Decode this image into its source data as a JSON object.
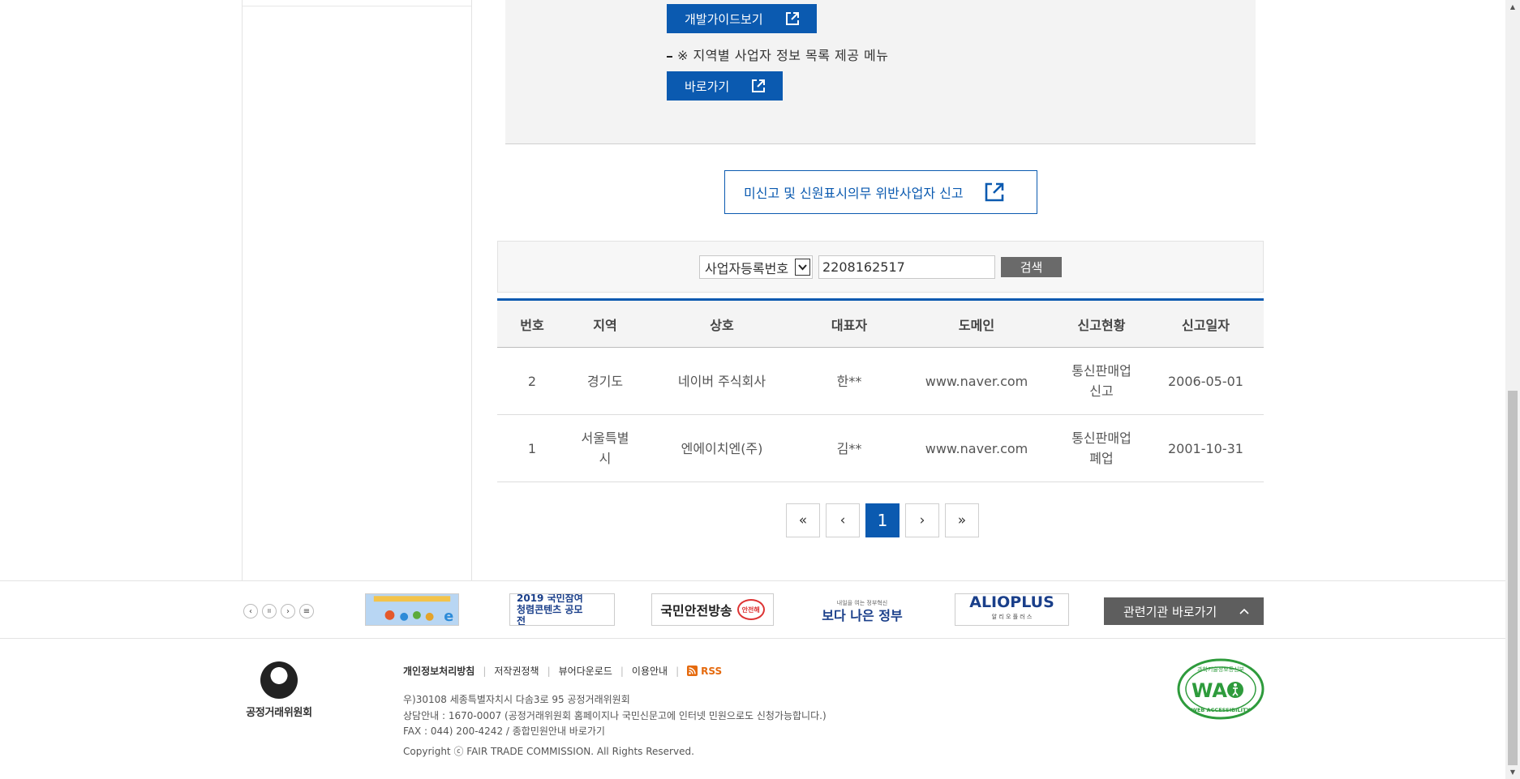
{
  "info_panel": {
    "dev_guide_button": "개발가이드보기",
    "description": "※ 지역별 사업자 정보 목록 제공 메뉴",
    "goto_button": "바로가기"
  },
  "report_button": "미신고 및 신원표시의무 위반사업자 신고",
  "search": {
    "select_value": "사업자등록번호",
    "input_value": "2208162517",
    "button_label": "검색"
  },
  "table": {
    "headers": [
      "번호",
      "지역",
      "상호",
      "대표자",
      "도메인",
      "신고현황",
      "신고일자"
    ],
    "rows": [
      {
        "no": "2",
        "region": "경기도",
        "company": "네이버 주식회사",
        "ceo": "한**",
        "domain": "www.naver.com",
        "status": "통신판매업 신고",
        "date": "2006-05-01"
      },
      {
        "no": "1",
        "region": "서울특별시",
        "company": "엔에이치엔(주)",
        "ceo": "김**",
        "domain": "www.naver.com",
        "status": "통신판매업 폐업",
        "date": "2001-10-31"
      }
    ]
  },
  "pagination": {
    "first": "«",
    "prev": "‹",
    "current": "1",
    "next": "›",
    "last": "»"
  },
  "banners": {
    "controls": [
      "‹",
      "II",
      "›",
      "≡"
    ],
    "items": [
      {
        "label": "",
        "icon": "banner-ie-image"
      },
      {
        "label": "2019 국민참여 청렴콘텐츠 공모전"
      },
      {
        "label": "국민안전방송",
        "badge": "안전해"
      },
      {
        "label": "보다 나은 정부",
        "small": "내일을 여는 정부혁신"
      },
      {
        "label": "ALIOPLUS",
        "small": "알 리 오 플 러 스"
      }
    ],
    "related_button": "관련기관 바로가기"
  },
  "footer": {
    "org_name": "공정거래위원회",
    "links": [
      "개인정보처리방침",
      "저작권정책",
      "뷰어다운로드",
      "이용안내"
    ],
    "rss_label": "RSS",
    "address": "우)30108 세종특별자치시 다솜3로 95 공정거래위원회",
    "consult": "상담안내 : 1670-0007 (공정거래위원회 홈페이지나 국민신문고에 인터넷 민원으로도 신청가능합니다.)",
    "fax": "FAX : 044) 200-4242 / 종합민원안내 바로가기",
    "copyright": "Copyright ⓒ FAIR TRADE COMMISSION. All Rights Reserved.",
    "wa_top": "과학기술정보통신부",
    "wa_main": "WA",
    "wa_bottom": "WEB ACCESSIBILITY"
  },
  "colors": {
    "primary_blue": "#0b5ab0",
    "gray_button": "#6a6a6a",
    "rss_orange": "#e56a0e",
    "wa_green": "#2e9b3c"
  }
}
